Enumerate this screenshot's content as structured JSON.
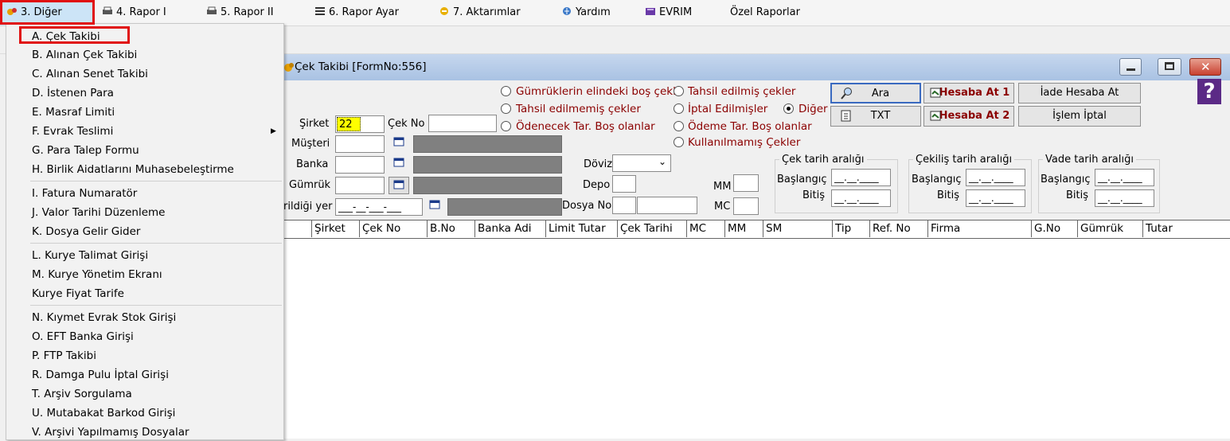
{
  "menubar": {
    "items": [
      {
        "label": "3.  Diğer",
        "icon": "app-star-icon"
      },
      {
        "label": "4.   Rapor I",
        "icon": "printer-icon"
      },
      {
        "label": "5.   Rapor II",
        "icon": "printer-icon"
      },
      {
        "label": "6.   Rapor Ayar",
        "icon": "report-settings-icon"
      },
      {
        "label": "7.   Aktarımlar",
        "icon": "transfer-icon"
      },
      {
        "label": "Yardım",
        "icon": "help-globe-icon"
      },
      {
        "label": "EVRIM",
        "icon": "book-icon"
      },
      {
        "label": "Özel Raporlar",
        "icon": ""
      }
    ]
  },
  "dropdown": {
    "items": [
      "A.   Çek Takibi",
      "B.   Alınan Çek Takibi",
      "C.   Alınan Senet Takibi",
      "D.   İstenen Para",
      "E.   Masraf Limiti",
      "F.   Evrak Teslimi",
      "G.   Para Talep Formu",
      "H.   Birlik Aidatlarını Muhasebeleştirme",
      "I.   Fatura Numaratör",
      "J.   Valor Tarihi Düzenleme",
      "K.   Dosya Gelir Gider",
      "L.    Kurye Talimat Girişi",
      "M.   Kurye Yönetim Ekranı",
      "Kurye Fiyat Tarife",
      "N.    Kıymet Evrak Stok Girişi",
      "O.   EFT Banka Girişi",
      "P.   FTP Takibi",
      "R.    Damga Pulu İptal  Girişi",
      "T. Arşiv Sorgulama",
      "U. Mutabakat Barkod Girişi",
      "V. Arşivi Yapılmamış Dosyalar"
    ],
    "submenu_arrow": "▶"
  },
  "window": {
    "title": "Çek Takibi [FormNo:556]",
    "controls": {
      "min": "—",
      "max": "☐",
      "close": "✕"
    }
  },
  "form": {
    "sirket_label": "Şirket",
    "sirket_value": "22",
    "cekno_label": "Çek No",
    "musteri_label": "Müşteri",
    "banka_label": "Banka",
    "gumruk_label": "Gümrük",
    "verildigi_label": "rildiği yer",
    "verildigi_value": "___-__-___-___",
    "doviz_label": "Döviz",
    "depo_label": "Depo",
    "dosyano_label": "Dosya No",
    "mm_label": "MM",
    "mc_label": "MC"
  },
  "radios": [
    {
      "label": "Gümrüklerin elindeki boş çekl",
      "checked": false
    },
    {
      "label": "Tahsil edilmemiş çekler",
      "checked": false
    },
    {
      "label": "Ödenecek Tar. Boş olanlar",
      "checked": false
    },
    {
      "label": "Tahsil edilmiş çekler",
      "checked": false
    },
    {
      "label": "İptal Edilmişler",
      "checked": false
    },
    {
      "label": "Diğer",
      "checked": true
    },
    {
      "label": "Ödeme Tar. Boş olanlar",
      "checked": false
    },
    {
      "label": "Kullanılmamış Çekler",
      "checked": false
    }
  ],
  "buttons": {
    "ara": "Ara",
    "txt": "TXT",
    "hesaba1": "Hesaba At 1",
    "hesaba2": "Hesaba At 2",
    "iade": "İade Hesaba At",
    "iptal": "İşlem İptal",
    "help": "?"
  },
  "date_groups": [
    {
      "title": "Çek tarih aralığı",
      "start_label": "Başlangıç",
      "end_label": "Bitiş",
      "placeholder": "__.__.____"
    },
    {
      "title": "Çekiliş tarih aralığı",
      "start_label": "Başlangıç",
      "end_label": "Bitiş",
      "placeholder": "__.__.____"
    },
    {
      "title": "Vade tarih aralığı",
      "start_label": "Başlangıç",
      "end_label": "Bitiş",
      "placeholder": "__.__.____"
    }
  ],
  "table": {
    "columns": [
      "Şirket",
      "Çek No",
      "B.No",
      "Banka Adi",
      "Limit Tutar",
      "Çek Tarihi",
      "MC",
      "MM",
      "SM",
      "Tip",
      "Ref. No",
      "Firma",
      "G.No",
      "Gümrük",
      "Tutar"
    ]
  },
  "colors": {
    "highlight_red": "#e01010",
    "label_dark_red": "#8b0000",
    "sirket_field_yellow": "#ffff00",
    "menu_selected": "#cce4f7"
  }
}
